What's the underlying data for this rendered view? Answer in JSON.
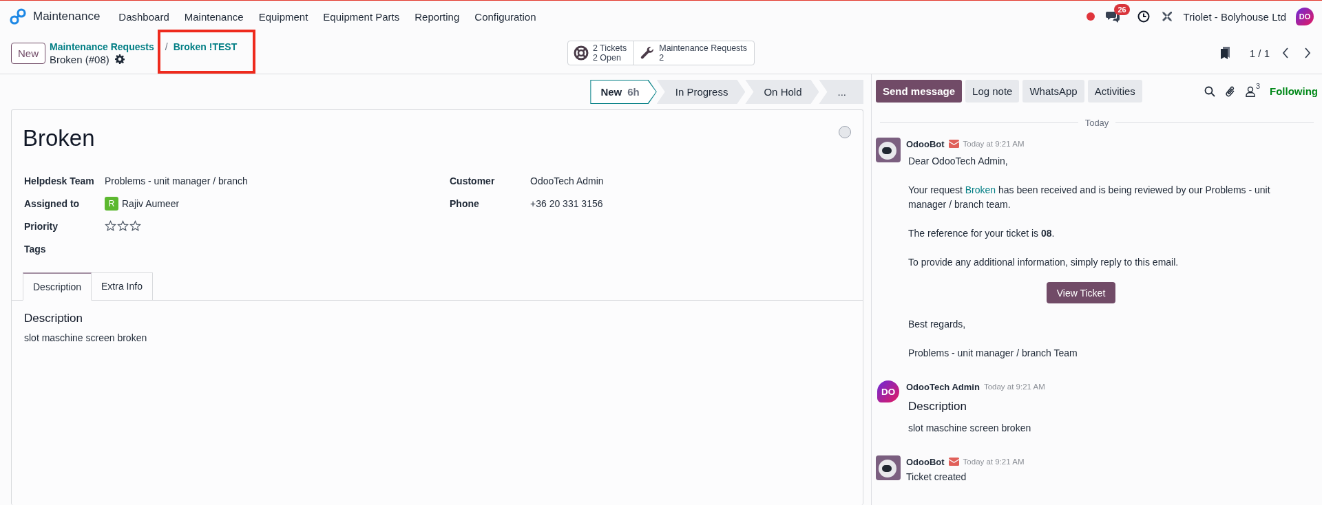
{
  "navbar": {
    "app_name": "Maintenance",
    "menu": [
      "Dashboard",
      "Maintenance",
      "Equipment",
      "Equipment Parts",
      "Reporting",
      "Configuration"
    ],
    "message_count": "26",
    "company": "Triolet - Bolyhouse Ltd",
    "avatar_initials": "DO"
  },
  "control_panel": {
    "new_button": "New",
    "separator": "/",
    "breadcrumb": [
      {
        "label": "Maintenance Requests",
        "highlighted": false
      },
      {
        "label": "Broken !TEST",
        "highlighted": true
      }
    ],
    "record": "Broken (#08)",
    "smart_buttons": [
      {
        "kind": "lifebuoy",
        "lines": [
          "2 Tickets",
          "2 Open"
        ]
      },
      {
        "kind": "wrench",
        "lines": [
          "Maintenance Requests",
          "2"
        ]
      }
    ],
    "pager": "1 / 1"
  },
  "status_bar": {
    "stages": [
      {
        "label": "New",
        "duration": "6h",
        "selected": true
      },
      {
        "label": "In Progress",
        "selected": false
      },
      {
        "label": "On Hold",
        "selected": false
      },
      {
        "label": "...",
        "selected": false
      }
    ]
  },
  "form": {
    "title": "Broken",
    "fields_left": [
      {
        "kind": "text",
        "label": "Helpdesk Team",
        "value": "Problems - unit manager / branch"
      },
      {
        "kind": "user",
        "label": "Assigned to",
        "avatar": "R",
        "value": "Rajiv Aumeer"
      },
      {
        "kind": "priority",
        "label": "Priority",
        "stars": 0
      },
      {
        "kind": "empty",
        "label": "Tags"
      }
    ],
    "fields_right": [
      {
        "kind": "text",
        "label": "Customer",
        "value": "OdooTech Admin"
      },
      {
        "kind": "text",
        "label": "Phone",
        "value": "+36 20 331 3156"
      }
    ],
    "tabs": [
      {
        "label": "Description",
        "selected": true
      },
      {
        "label": "Extra Info",
        "selected": false
      }
    ],
    "description": {
      "heading": "Description",
      "text": "slot maschine screen broken"
    }
  },
  "chatter": {
    "buttons": [
      {
        "label": "Send message",
        "selected": true
      },
      {
        "label": "Log note",
        "selected": false
      },
      {
        "label": "WhatsApp",
        "selected": false
      },
      {
        "label": "Activities",
        "selected": false
      }
    ],
    "follower_count": "3",
    "follow_state": "Following",
    "date_divider": "Today",
    "messages": [
      {
        "author": "OdooBot",
        "kind": "bot",
        "email": true,
        "time": "Today at 9:21 AM",
        "body": [
          {
            "kind": "p",
            "text": "Dear OdooTech Admin,"
          },
          {
            "kind": "p_link",
            "before": "Your request ",
            "link": "Broken",
            "after": " has been received and is being reviewed by our Problems - unit manager / branch team."
          },
          {
            "kind": "p",
            "text": "The reference for your ticket is **08**."
          },
          {
            "kind": "p",
            "text": "To provide any additional information, simply reply to this email."
          },
          {
            "kind": "button",
            "text": "View Ticket"
          },
          {
            "kind": "p",
            "text": "Best regards,"
          },
          {
            "kind": "p",
            "text": "Problems - unit manager / branch Team"
          }
        ]
      },
      {
        "author": "OdooTech Admin",
        "kind": "user",
        "initials": "DO",
        "email": false,
        "time": "Today at 9:21 AM",
        "body": [
          {
            "kind": "h",
            "text": "Description"
          },
          {
            "kind": "p",
            "text": "slot maschine screen broken"
          }
        ]
      },
      {
        "author": "OdooBot",
        "kind": "bot",
        "email": true,
        "time": "Today at 9:21 AM",
        "body": [
          {
            "kind": "plain",
            "text": "Ticket created"
          }
        ]
      }
    ]
  }
}
